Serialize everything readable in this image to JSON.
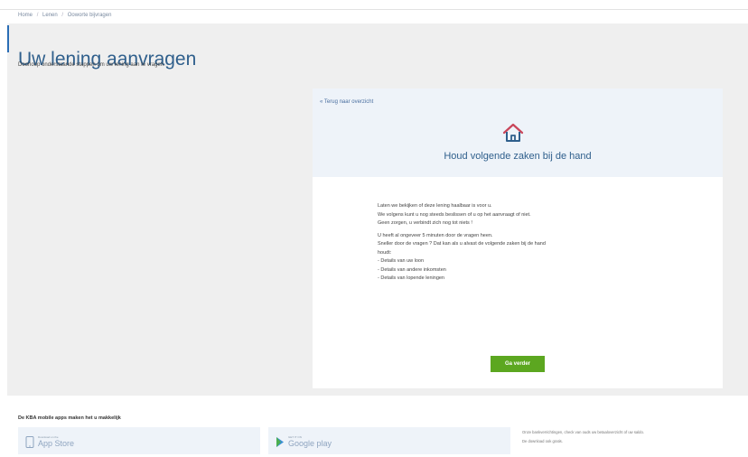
{
  "breadcrumb": {
    "items": [
      "Home",
      "Lenen",
      "Ooworte bijvragen"
    ],
    "separator": "/"
  },
  "header": {
    "title": "Uw lening aanvragen",
    "subtitle": "Doorloop onderstaande stappen om uw lening aan te vragen."
  },
  "card": {
    "back_link": "« Terug naar overzicht",
    "house_icon": "house-icon",
    "title": "Houd volgende zaken bij de hand",
    "paragraphs": [
      [
        "Laten we bekijken of deze lening haalbaar is voor u.",
        "We volgens kunt u nog steeds beslissen of u op het aanvraagt of niet.",
        "Geen zorgen, u verbindt zich nog tot niets !"
      ],
      [
        "U heeft al ongeveer 5 minuten door de vragen heen.",
        "Sneller door de vragen ? Dat kan als u alvast de volgende zaken bij de hand",
        "houdt:",
        "- Details van uw loon",
        "- Details van andere inkomsten",
        "- Details van lopende leningen"
      ]
    ],
    "button_label": "Ga verder"
  },
  "footer": {
    "title": "De KBA mobile apps maken het u makkelijk",
    "stores": [
      {
        "small": "Download on the",
        "name": "App Store",
        "icon": "phone-icon"
      },
      {
        "small": "GET IT ON",
        "name": "Google play",
        "icon": "play-icon"
      }
    ],
    "note_lines": [
      "Onze bankverrichtingen, check van ouds uw betaaloverzicht of uw saldo.",
      "De download ook gratis."
    ]
  },
  "colors": {
    "accent_blue": "#2f5f8c",
    "button_green": "#5ca720",
    "panel_bg": "#efefef",
    "card_head_bg": "#eef3f9"
  }
}
